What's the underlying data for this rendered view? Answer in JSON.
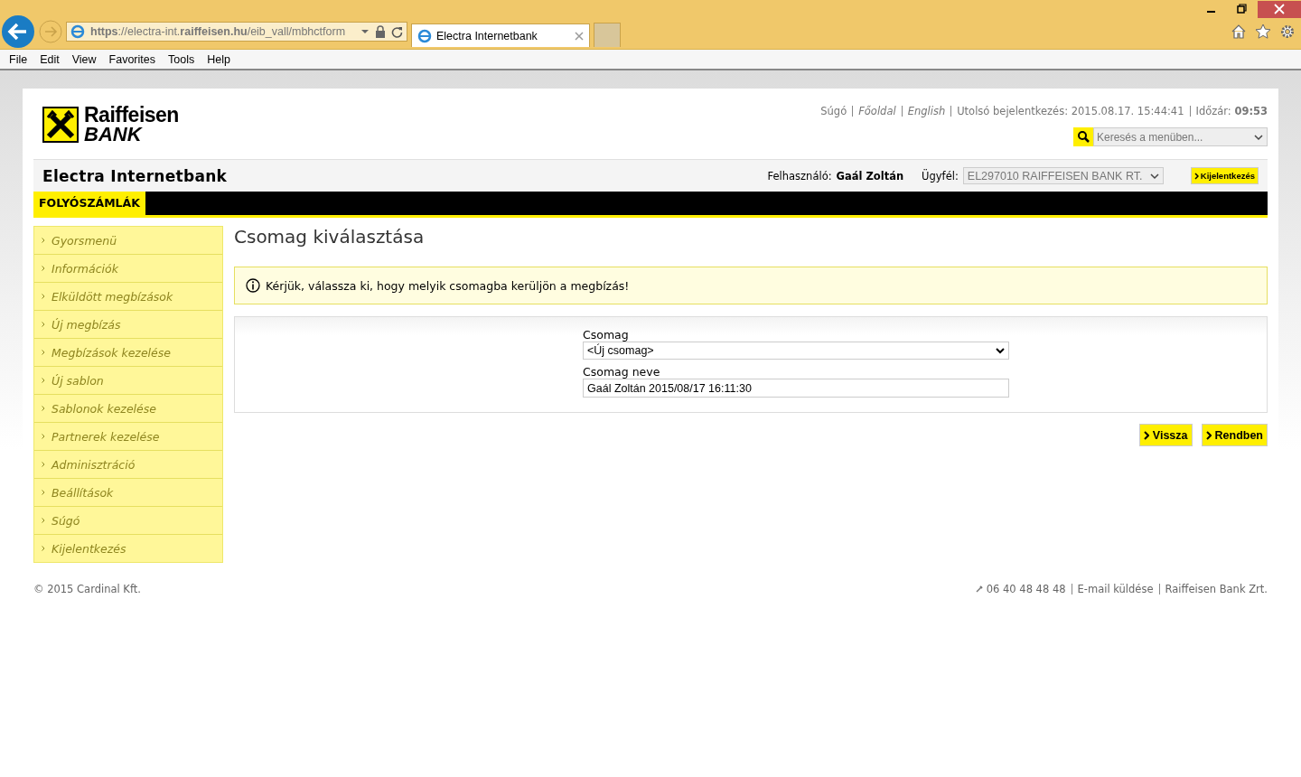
{
  "browser": {
    "url": "**https**://electra-int.**raiffeisen.hu**/eib_vall/mbhctform",
    "tabs": [
      {
        "title": "Electra Internetbank",
        "selected": true
      }
    ],
    "menu": [
      "File",
      "Edit",
      "View",
      "Favorites",
      "Tools",
      "Help"
    ]
  },
  "header": {
    "links": [
      {
        "text": "Súgó",
        "italic": false
      },
      {
        "text": "Főoldal",
        "italic": true
      },
      {
        "text": "English",
        "italic": true
      },
      {
        "text": "Utolsó bejelentkezés: 2015.08.17. 15:44:41",
        "italic": false
      },
      {
        "text": "Időzár: **09:53**",
        "italic": false
      }
    ],
    "search": {
      "placeholder": "Keresés a menüben..."
    },
    "logo": {
      "line1": "Raiffeisen",
      "line2": "BANK"
    }
  },
  "appbar": {
    "title": "Electra Internetbank",
    "user_label": "Felhasználó:",
    "user": "Gaál Zoltán",
    "client_label": "Ügyfél:",
    "client": "EL297010 RAIFFEISEN BANK RT.",
    "logout": "Kijelentkezés"
  },
  "nav_tabs": [
    {
      "label": "FOLYÓSZÁMLÁK",
      "selected": true
    }
  ],
  "sidebar": {
    "items": [
      {
        "label": "Gyorsmenü",
        "disabled": true
      },
      {
        "label": "Információk",
        "disabled": true
      },
      {
        "label": "Elküldött megbízások",
        "disabled": true
      },
      {
        "label": "Új megbízás",
        "disabled": true
      },
      {
        "label": "Megbízások kezelése",
        "disabled": true
      },
      {
        "label": "Új sablon",
        "disabled": true
      },
      {
        "label": "Sablonok kezelése",
        "disabled": true
      },
      {
        "label": "Partnerek kezelése",
        "disabled": true
      },
      {
        "label": "Adminisztráció",
        "disabled": true
      },
      {
        "label": "Beállítások",
        "disabled": true
      },
      {
        "label": "Súgó",
        "disabled": true
      },
      {
        "label": "Kijelentkezés",
        "disabled": true
      }
    ]
  },
  "main": {
    "title": "Csomag kiválasztása",
    "notice": "Kérjük, válassza ki, hogy melyik csomagba kerüljön a megbízás!",
    "form": {
      "package_label": "Csomag",
      "package_value": "<Új csomag>",
      "name_label": "Csomag neve",
      "name_value": "Gaál Zoltán 2015/08/17 16:11:30"
    },
    "buttons": [
      "Vissza",
      "Rendben"
    ]
  },
  "footer": {
    "copyright": "© 2015 Cardinal Kft.",
    "links": [
      "06 40 48 48 48",
      "E-mail küldése",
      "Raiffeisen Bank Zrt."
    ]
  }
}
